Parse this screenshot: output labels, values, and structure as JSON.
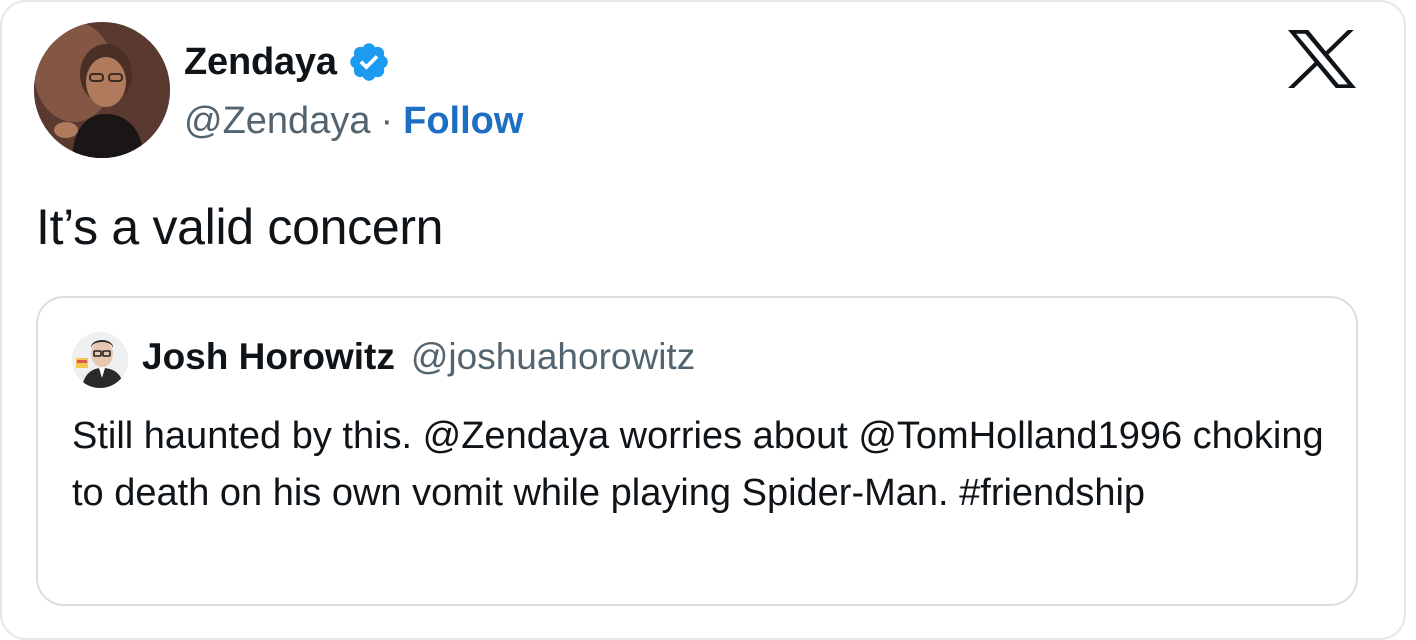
{
  "tweet": {
    "author_name": "Zendaya",
    "author_handle": "@Zendaya",
    "separator": "·",
    "follow_label": "Follow",
    "text": "It’s a valid concern"
  },
  "quoted": {
    "author_name": "Josh Horowitz",
    "author_handle": "@joshuahorowitz",
    "text": "Still haunted by this. @Zendaya worries about @TomHolland1996 choking to death on his own vomit while playing Spider-Man. #friendship"
  },
  "icons": {
    "verified": "verified-badge-icon",
    "platform_logo": "x-logo-icon"
  },
  "colors": {
    "accent": "#1d6fc4",
    "verified": "#1d9bf0",
    "secondary_text": "#536471",
    "border": "#d9dee3"
  }
}
